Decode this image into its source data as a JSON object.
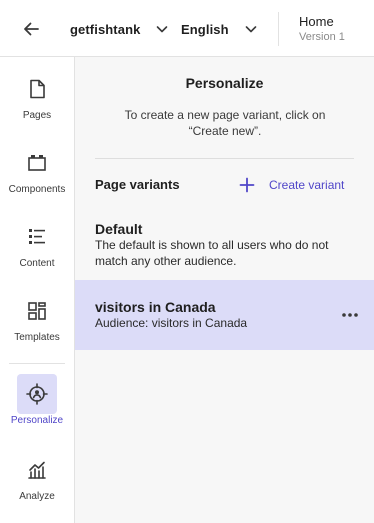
{
  "header": {
    "back_icon": "arrow-left-icon",
    "site_selector": {
      "value": "getfishtank",
      "icon": "chevron-down-icon"
    },
    "language_selector": {
      "value": "English",
      "icon": "chevron-down-icon"
    },
    "page": {
      "name": "Home",
      "version": "Version 1"
    }
  },
  "sidebar": {
    "items": [
      {
        "label": "Pages",
        "icon": "page-icon"
      },
      {
        "label": "Components",
        "icon": "components-icon"
      },
      {
        "label": "Content",
        "icon": "content-list-icon"
      },
      {
        "label": "Templates",
        "icon": "templates-icon"
      },
      {
        "label": "Personalize",
        "icon": "personalize-target-icon",
        "active": true
      },
      {
        "label": "Analyze",
        "icon": "analyze-chart-icon"
      }
    ]
  },
  "panel": {
    "title": "Personalize",
    "description": "To create a new page variant, click on “Create new”.",
    "variants_header": "Page variants",
    "create_button": {
      "label": "Create variant",
      "icon": "plus-icon"
    },
    "variants": [
      {
        "name": "Default",
        "description": "The default is shown to all users who do not match any other audience."
      },
      {
        "name": "visitors in Canada",
        "description": "Audience: visitors in Canada",
        "selected": true,
        "menu_icon": "more-horizontal-icon"
      }
    ]
  },
  "colors": {
    "accent": "#5046c8",
    "selected_bg": "#dcdcf8",
    "panel_bg": "#f7f7f7"
  }
}
